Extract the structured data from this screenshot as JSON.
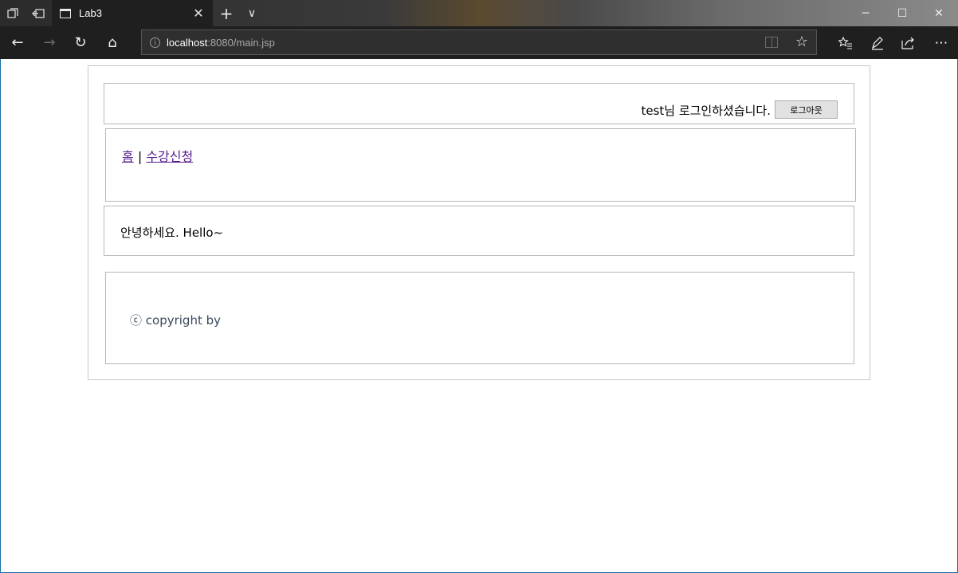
{
  "browser": {
    "tab": {
      "title": "Lab3"
    },
    "address": {
      "host": "localhost",
      "path": ":8080/main.jsp"
    },
    "icons": {
      "tab_actions": "tab-actions-icon",
      "set_aside": "set-aside-tabs-icon",
      "new_tab": "+",
      "tab_list": "∨",
      "close_tab": "✕",
      "minimize": "─",
      "maximize": "☐",
      "close_window": "✕",
      "back": "←",
      "forward": "→",
      "refresh": "↻",
      "home": "⌂",
      "favorite": "☆",
      "favorites_hub": "☆≡",
      "notes": "✎",
      "share": "⇪",
      "more": "⋯"
    }
  },
  "page": {
    "header": {
      "login_status": "test님 로그인하셨습니다.",
      "logout_label": "로그아웃"
    },
    "nav": {
      "home_label": "홈",
      "separator": "|",
      "enroll_label": "수강신청"
    },
    "main": {
      "greeting": "안녕하세요. Hello~"
    },
    "footer": {
      "copyright": "ⓒ copyright by"
    },
    "colors": {
      "visited_link": "#551a8b",
      "border": "#b8b8b8",
      "footer_text": "#3a4a5a"
    }
  }
}
